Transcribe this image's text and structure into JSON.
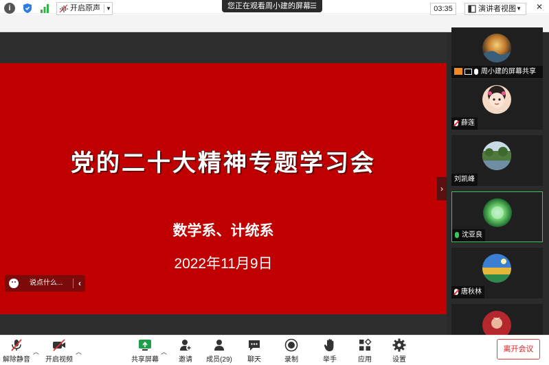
{
  "window": {
    "title": "您正在观看周小建的屏幕",
    "min_label": "—",
    "max_label": "☐",
    "close_label": "✕"
  },
  "toolbar": {
    "orig_audio_label": "开启原声",
    "timer": "03:35",
    "view_label": "演讲者视图"
  },
  "slide": {
    "title": "党的二十大精神专题学习会",
    "department": "数学系、计统系",
    "date": "2022年11月9日"
  },
  "chat": {
    "placeholder": "说点什么..."
  },
  "participants": [
    {
      "name": "周小建的屏幕共享",
      "sharing": true
    },
    {
      "name": "薛莲",
      "muted": true
    },
    {
      "name": "刘凯峰"
    },
    {
      "name": "沈亚良",
      "speaking": true
    },
    {
      "name": "唐秋林",
      "muted": true
    }
  ],
  "bottom": {
    "unmute": "解除静音",
    "video": "开启视频",
    "share": "共享屏幕",
    "invite": "邀请",
    "members": "成员(29)",
    "chat": "聊天",
    "record": "录制",
    "raise_hand": "举手",
    "apps": "应用",
    "settings": "设置",
    "leave": "离开会议"
  },
  "colors": {
    "slide_red": "#c00000",
    "speaking_green": "#3cc45c",
    "leave_red": "#e02020"
  }
}
